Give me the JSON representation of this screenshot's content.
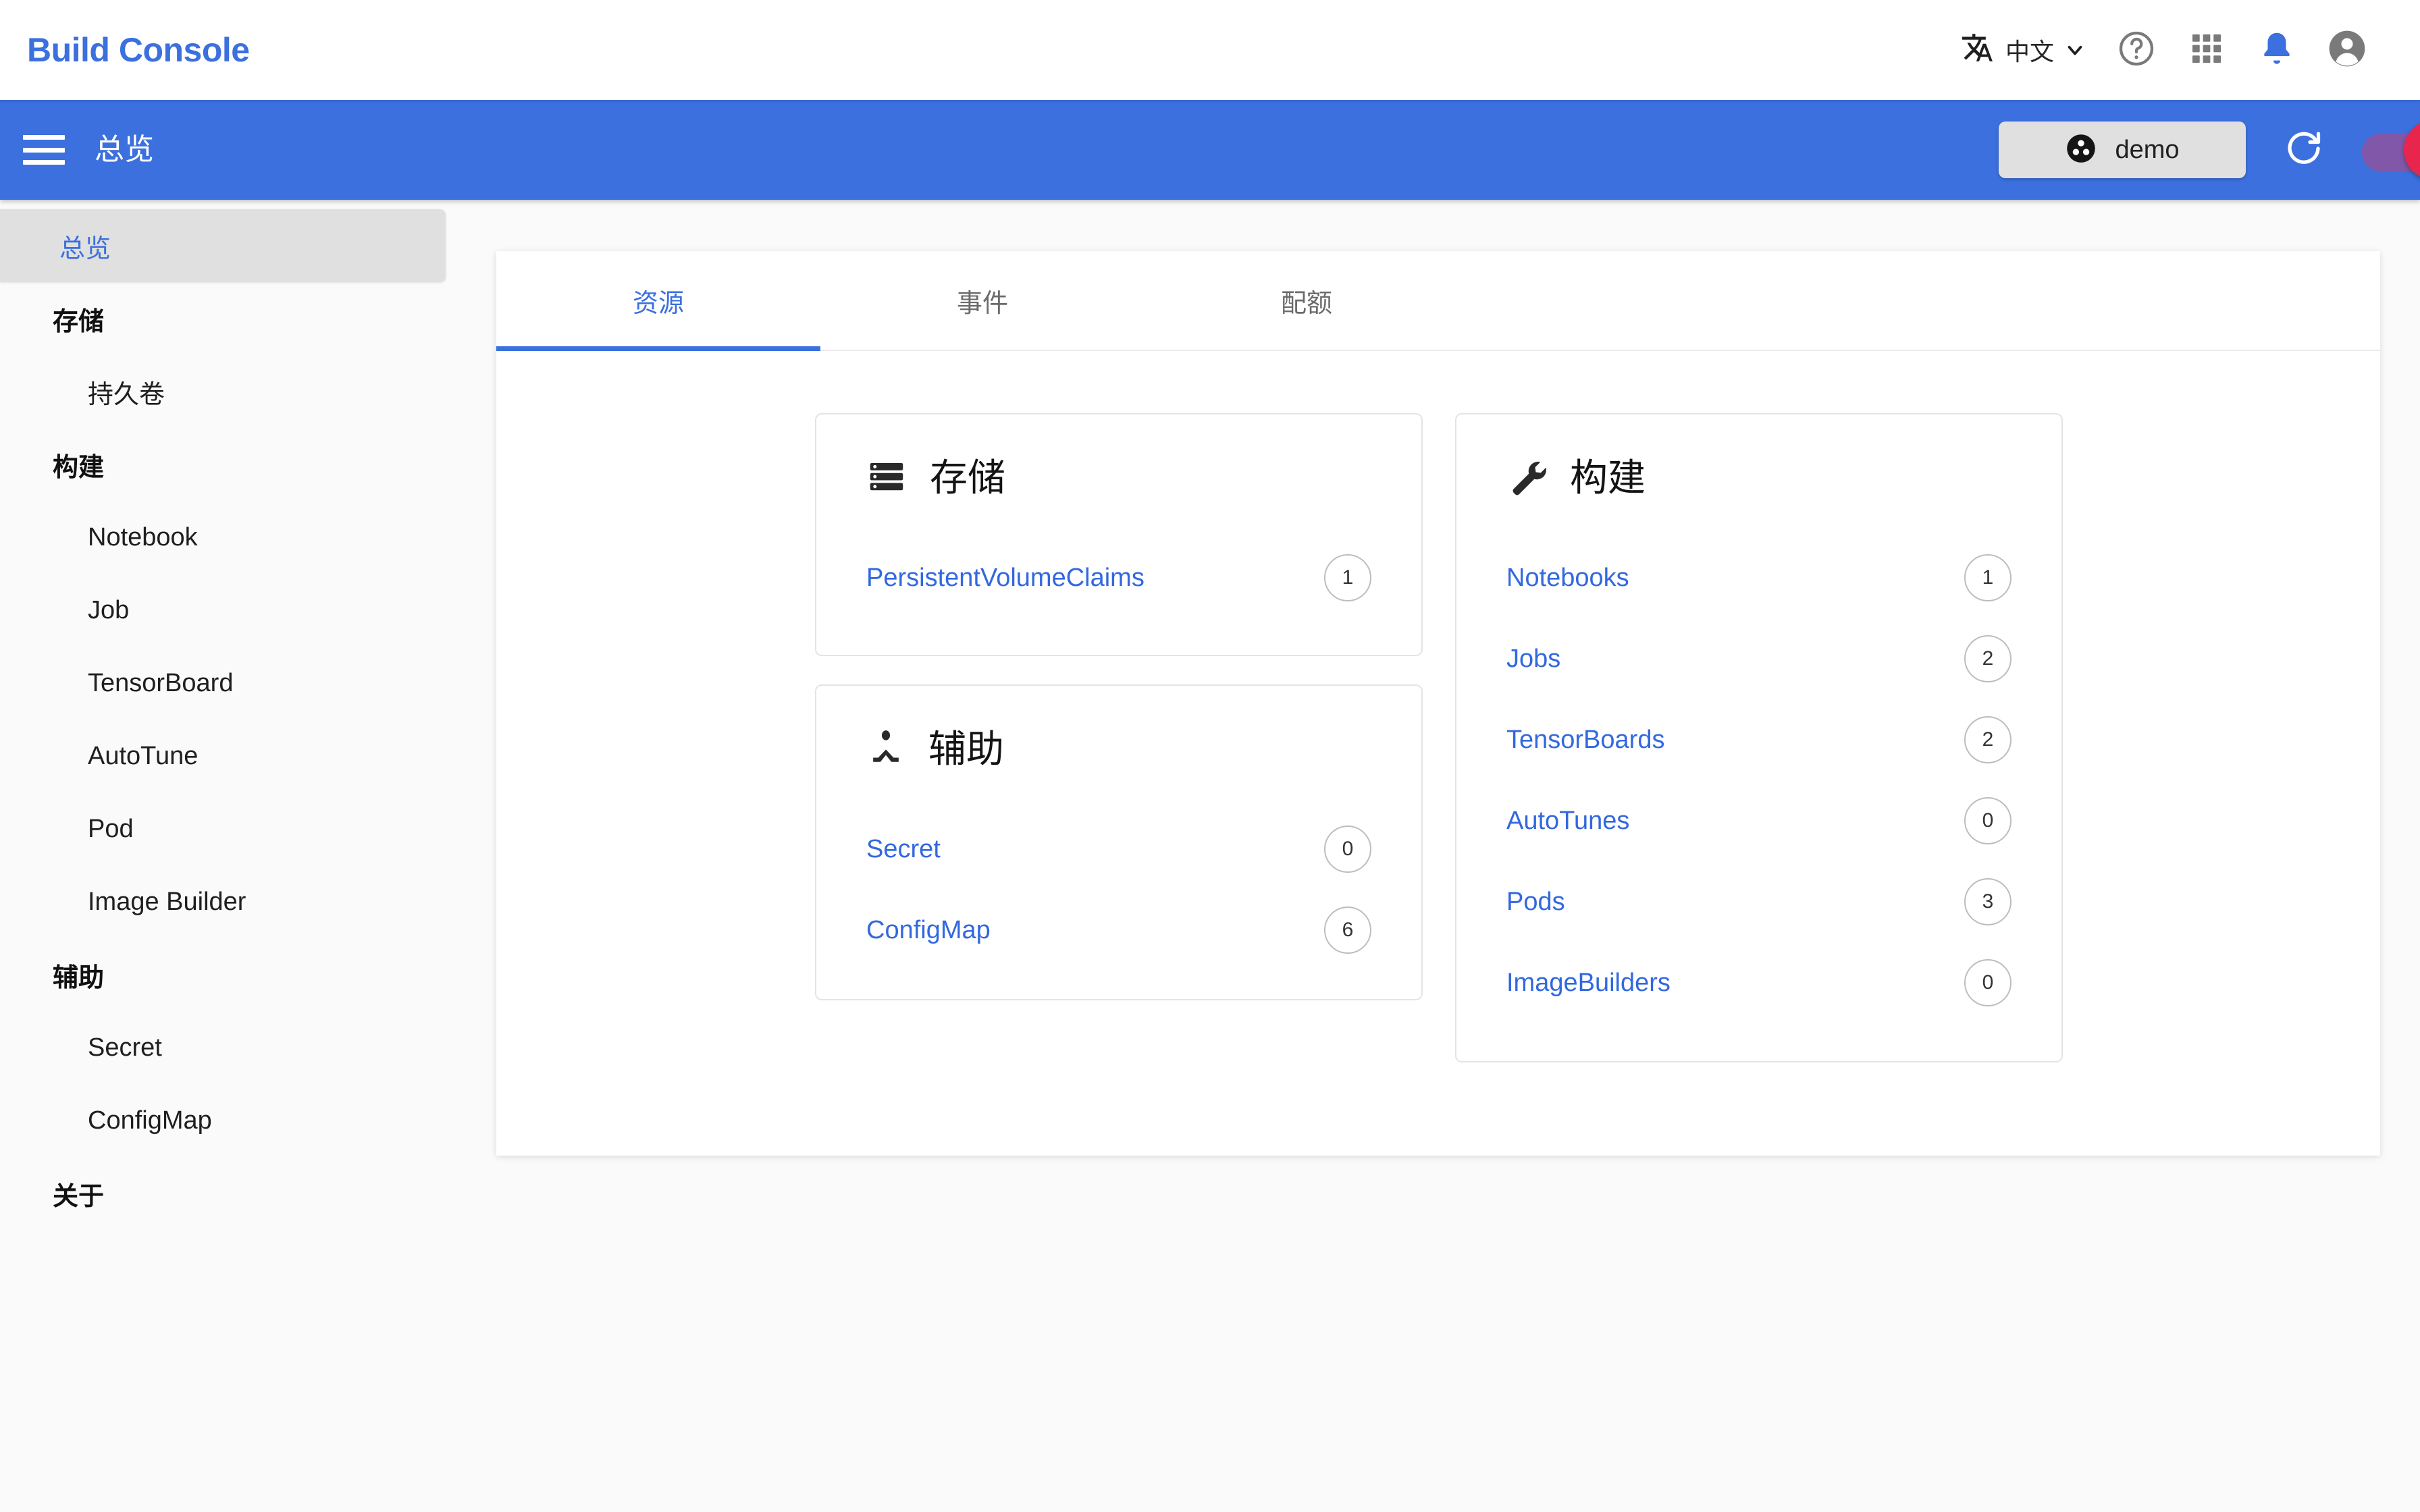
{
  "topbar": {
    "brand": "Build Console",
    "language": {
      "label": "中文",
      "icon": "translate-icon",
      "chevron": "chevron-down-icon"
    },
    "icons": [
      {
        "name": "help-icon",
        "title": "?"
      },
      {
        "name": "apps-grid-icon",
        "title": ""
      },
      {
        "name": "notifications-bell-icon",
        "title": ""
      },
      {
        "name": "account-avatar-icon",
        "title": ""
      }
    ],
    "accent_color": "#3b70de",
    "bell_color": "#3b70de"
  },
  "appbar": {
    "menu_icon": "hamburger-menu-icon",
    "title": "总览",
    "namespace_chip": {
      "label": "demo",
      "icon": "namespace-icon"
    },
    "refresh_icon": "refresh-icon",
    "toggle": {
      "name": "theme-toggle",
      "state": "on",
      "track_color": "#8e54a0",
      "thumb_color": "#e8264d"
    },
    "bg_color": "#3b70de"
  },
  "sidebar": {
    "items": [
      {
        "label": "总览",
        "type": "item",
        "active": true
      },
      {
        "label": "存储",
        "type": "header",
        "active": false
      },
      {
        "label": "持久卷",
        "type": "sub",
        "active": false
      },
      {
        "label": "构建",
        "type": "header",
        "active": false
      },
      {
        "label": "Notebook",
        "type": "sub",
        "active": false
      },
      {
        "label": "Job",
        "type": "sub",
        "active": false
      },
      {
        "label": "TensorBoard",
        "type": "sub",
        "active": false
      },
      {
        "label": "AutoTune",
        "type": "sub",
        "active": false
      },
      {
        "label": "Pod",
        "type": "sub",
        "active": false
      },
      {
        "label": "Image Builder",
        "type": "sub",
        "active": false
      },
      {
        "label": "辅助",
        "type": "header",
        "active": false
      },
      {
        "label": "Secret",
        "type": "sub",
        "active": false
      },
      {
        "label": "ConfigMap",
        "type": "sub",
        "active": false
      },
      {
        "label": "关于",
        "type": "header",
        "active": false
      }
    ],
    "active_bg": "#e0e0e0",
    "active_fg": "#3b70de"
  },
  "main": {
    "tabs": [
      {
        "label": "资源",
        "active": true
      },
      {
        "label": "事件",
        "active": false
      },
      {
        "label": "配额",
        "active": false
      }
    ],
    "cards": [
      {
        "id": "storage",
        "title": "存储",
        "icon": "storage-stack-icon",
        "rows": [
          {
            "label": "PersistentVolumeClaims",
            "count": "1"
          }
        ]
      },
      {
        "id": "helper",
        "title": "辅助",
        "icon": "person-accessibility-icon",
        "rows": [
          {
            "label": "Secret",
            "count": "0"
          },
          {
            "label": "ConfigMap",
            "count": "6"
          }
        ]
      },
      {
        "id": "build",
        "title": "构建",
        "icon": "wrench-build-icon",
        "rows": [
          {
            "label": "Notebooks",
            "count": "1"
          },
          {
            "label": "Jobs",
            "count": "2"
          },
          {
            "label": "TensorBoards",
            "count": "2"
          },
          {
            "label": "AutoTunes",
            "count": "0"
          },
          {
            "label": "Pods",
            "count": "3"
          },
          {
            "label": "ImageBuilders",
            "count": "0"
          }
        ]
      }
    ],
    "link_color": "#3268e0"
  }
}
